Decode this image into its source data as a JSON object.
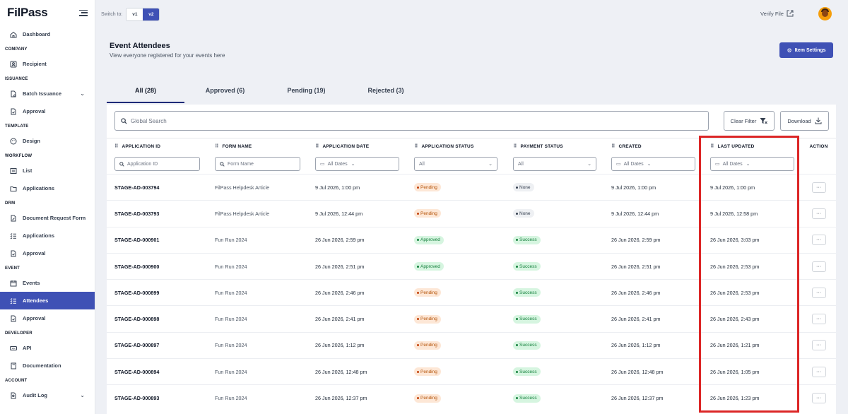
{
  "app": {
    "logo_text": "FilPass"
  },
  "sidebar": {
    "items": [
      {
        "type": "item",
        "label": "Dashboard",
        "icon": "home-icon"
      },
      {
        "type": "section",
        "label": "COMPANY"
      },
      {
        "type": "item",
        "label": "Recipient",
        "icon": "contact-icon"
      },
      {
        "type": "section",
        "label": "ISSUANCE"
      },
      {
        "type": "item",
        "label": "Batch Issuance",
        "icon": "document-gear-icon",
        "expandable": true
      },
      {
        "type": "item",
        "label": "Approval",
        "icon": "document-check-icon"
      },
      {
        "type": "section",
        "label": "TEMPLATE"
      },
      {
        "type": "item",
        "label": "Design",
        "icon": "palette-icon"
      },
      {
        "type": "section",
        "label": "WORKFLOW"
      },
      {
        "type": "item",
        "label": "List",
        "icon": "list-icon"
      },
      {
        "type": "item",
        "label": "Applications",
        "icon": "folder-icon"
      },
      {
        "type": "section",
        "label": "DRM"
      },
      {
        "type": "item",
        "label": "Document Request Form",
        "icon": "document-edit-icon"
      },
      {
        "type": "item",
        "label": "Applications",
        "icon": "checklist-icon"
      },
      {
        "type": "item",
        "label": "Approval",
        "icon": "document-check-icon"
      },
      {
        "type": "section",
        "label": "EVENT"
      },
      {
        "type": "item",
        "label": "Events",
        "icon": "calendar-icon"
      },
      {
        "type": "item",
        "label": "Attendees",
        "icon": "checklist-icon",
        "active": true
      },
      {
        "type": "item",
        "label": "Approval",
        "icon": "document-check-icon"
      },
      {
        "type": "section",
        "label": "DEVELOPER"
      },
      {
        "type": "item",
        "label": "API",
        "icon": "api-icon"
      },
      {
        "type": "item",
        "label": "Documentation",
        "icon": "book-icon"
      },
      {
        "type": "section",
        "label": "ACCOUNT"
      },
      {
        "type": "item",
        "label": "Audit Log",
        "icon": "document-search-icon",
        "expandable": true
      }
    ]
  },
  "topbar": {
    "switch_label": "Switch to:",
    "v1": "v1",
    "v2": "v2",
    "verify_label": "Verify File"
  },
  "header": {
    "title": "Event Attendees",
    "subtitle": "View everyone registered for your events here",
    "settings_label": "Item Settings"
  },
  "tabs": [
    {
      "label": "All (28)",
      "active": true
    },
    {
      "label": "Approved (6)"
    },
    {
      "label": "Pending (19)"
    },
    {
      "label": "Rejected (3)"
    }
  ],
  "toolbar": {
    "search_placeholder": "Global Search",
    "clear_label": "Clear Filter",
    "download_label": "Download"
  },
  "table": {
    "columns": [
      "APPLICATION ID",
      "FORM NAME",
      "APPLICATION DATE",
      "APPLICATION STATUS",
      "PAYMENT STATUS",
      "CREATED",
      "LAST UPDATED",
      "ACTION"
    ],
    "filters": {
      "app_id_placeholder": "Application ID",
      "form_name_placeholder": "Form Name",
      "all_dates": "All Dates",
      "all": "All"
    },
    "action_label": "···",
    "rows": [
      {
        "id": "STAGE-AD-003794",
        "form": "FilPass Helpdesk Article",
        "app_date": "9 Jul 2026, 1:00 pm",
        "app_status": "Pending",
        "pay_status": "None",
        "created": "9 Jul 2026, 1:00 pm",
        "updated": "9 Jul 2026, 1:00 pm"
      },
      {
        "id": "STAGE-AD-003793",
        "form": "FilPass Helpdesk Article",
        "app_date": "9 Jul 2026, 12:44 pm",
        "app_status": "Pending",
        "pay_status": "None",
        "created": "9 Jul 2026, 12:44 pm",
        "updated": "9 Jul 2026, 12:58 pm"
      },
      {
        "id": "STAGE-AD-000901",
        "form": "Fun Run 2024",
        "app_date": "26 Jun 2026, 2:59 pm",
        "app_status": "Approved",
        "pay_status": "Success",
        "created": "26 Jun 2026, 2:59 pm",
        "updated": "26 Jun 2026, 3:03 pm"
      },
      {
        "id": "STAGE-AD-000900",
        "form": "Fun Run 2024",
        "app_date": "26 Jun 2026, 2:51 pm",
        "app_status": "Approved",
        "pay_status": "Success",
        "created": "26 Jun 2026, 2:51 pm",
        "updated": "26 Jun 2026, 2:53 pm"
      },
      {
        "id": "STAGE-AD-000899",
        "form": "Fun Run 2024",
        "app_date": "26 Jun 2026, 2:46 pm",
        "app_status": "Pending",
        "pay_status": "Success",
        "created": "26 Jun 2026, 2:46 pm",
        "updated": "26 Jun 2026, 2:53 pm"
      },
      {
        "id": "STAGE-AD-000898",
        "form": "Fun Run 2024",
        "app_date": "26 Jun 2026, 2:41 pm",
        "app_status": "Pending",
        "pay_status": "Success",
        "created": "26 Jun 2026, 2:41 pm",
        "updated": "26 Jun 2026, 2:43 pm"
      },
      {
        "id": "STAGE-AD-000897",
        "form": "Fun Run 2024",
        "app_date": "26 Jun 2026, 1:12 pm",
        "app_status": "Pending",
        "pay_status": "Success",
        "created": "26 Jun 2026, 1:12 pm",
        "updated": "26 Jun 2026, 1:21 pm"
      },
      {
        "id": "STAGE-AD-000894",
        "form": "Fun Run 2024",
        "app_date": "26 Jun 2026, 12:48 pm",
        "app_status": "Pending",
        "pay_status": "Success",
        "created": "26 Jun 2026, 12:48 pm",
        "updated": "26 Jun 2026, 1:05 pm"
      },
      {
        "id": "STAGE-AD-000893",
        "form": "Fun Run 2024",
        "app_date": "26 Jun 2026, 12:37 pm",
        "app_status": "Pending",
        "pay_status": "Success",
        "created": "26 Jun 2026, 12:37 pm",
        "updated": "26 Jun 2026, 1:23 pm"
      }
    ]
  },
  "colors": {
    "primary": "#3f51b5",
    "highlight": "#dc2626",
    "pending_bg": "#fde7d6",
    "success_bg": "#d6f5e0"
  }
}
